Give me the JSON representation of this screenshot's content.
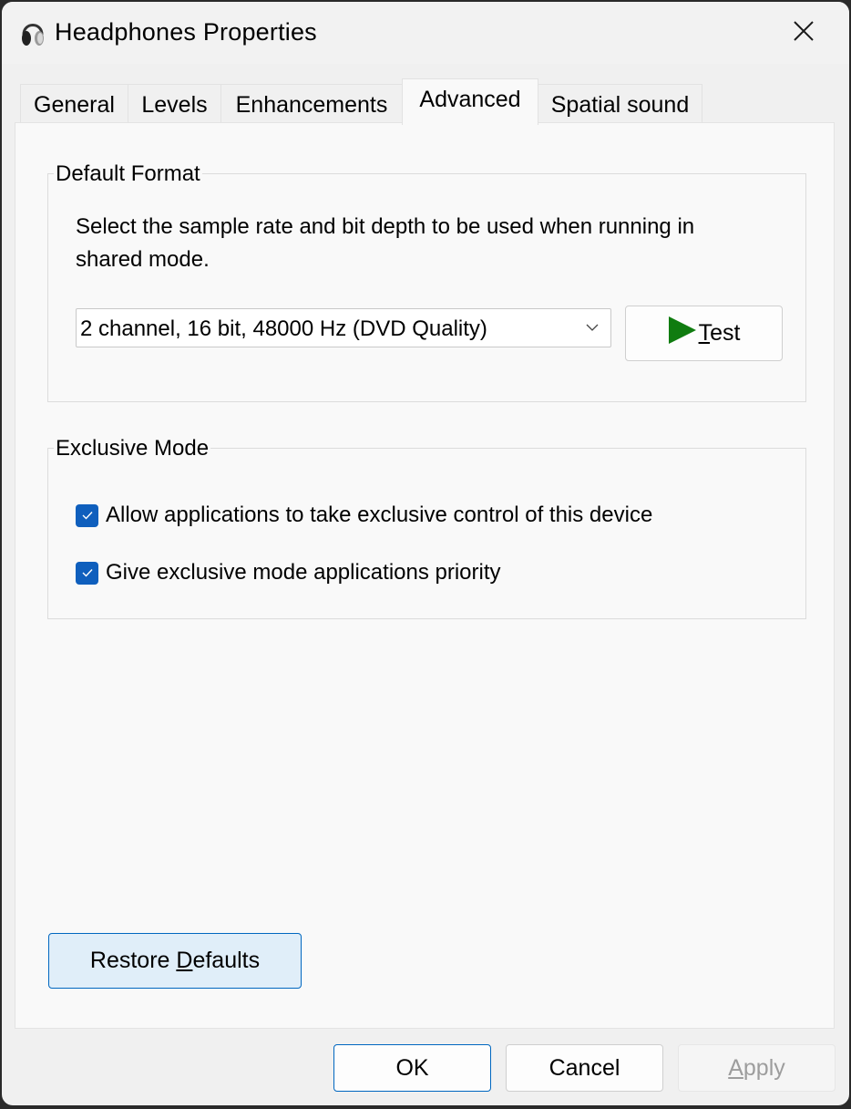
{
  "window": {
    "title": "Headphones Properties",
    "icon": "headphones-icon",
    "close_icon": "close-icon"
  },
  "tabs": [
    {
      "label": "General",
      "active": false
    },
    {
      "label": "Levels",
      "active": false
    },
    {
      "label": "Enhancements",
      "active": false
    },
    {
      "label": "Advanced",
      "active": true
    },
    {
      "label": "Spatial sound",
      "active": false
    }
  ],
  "default_format": {
    "label": "Default Format",
    "description_line1": "Select the sample rate and bit depth to be used when running in",
    "description_line2": "shared mode.",
    "format_select": {
      "value": "2 channel, 16 bit, 48000 Hz (DVD Quality)",
      "icon": "chevron-down-icon"
    },
    "test_button": {
      "label_prefix": "",
      "label_mnemonic": "T",
      "label_rest": "est",
      "icon": "play-icon",
      "icon_color": "#107c10"
    }
  },
  "exclusive_mode": {
    "label": "Exclusive Mode",
    "options": [
      {
        "label": "Allow applications to take exclusive control of this device",
        "checked": true
      },
      {
        "label": "Give exclusive mode applications priority",
        "checked": true
      }
    ]
  },
  "restore_defaults": {
    "label_prefix": "Restore ",
    "label_mnemonic": "D",
    "label_rest": "efaults"
  },
  "footer": {
    "ok": "OK",
    "cancel": "Cancel",
    "apply_mnemonic": "A",
    "apply_rest": "pply",
    "apply_enabled": false
  },
  "colors": {
    "accent": "#0f5fbd",
    "play": "#107c10",
    "restore_bg": "#e0eef9",
    "restore_border": "#0067c0"
  }
}
